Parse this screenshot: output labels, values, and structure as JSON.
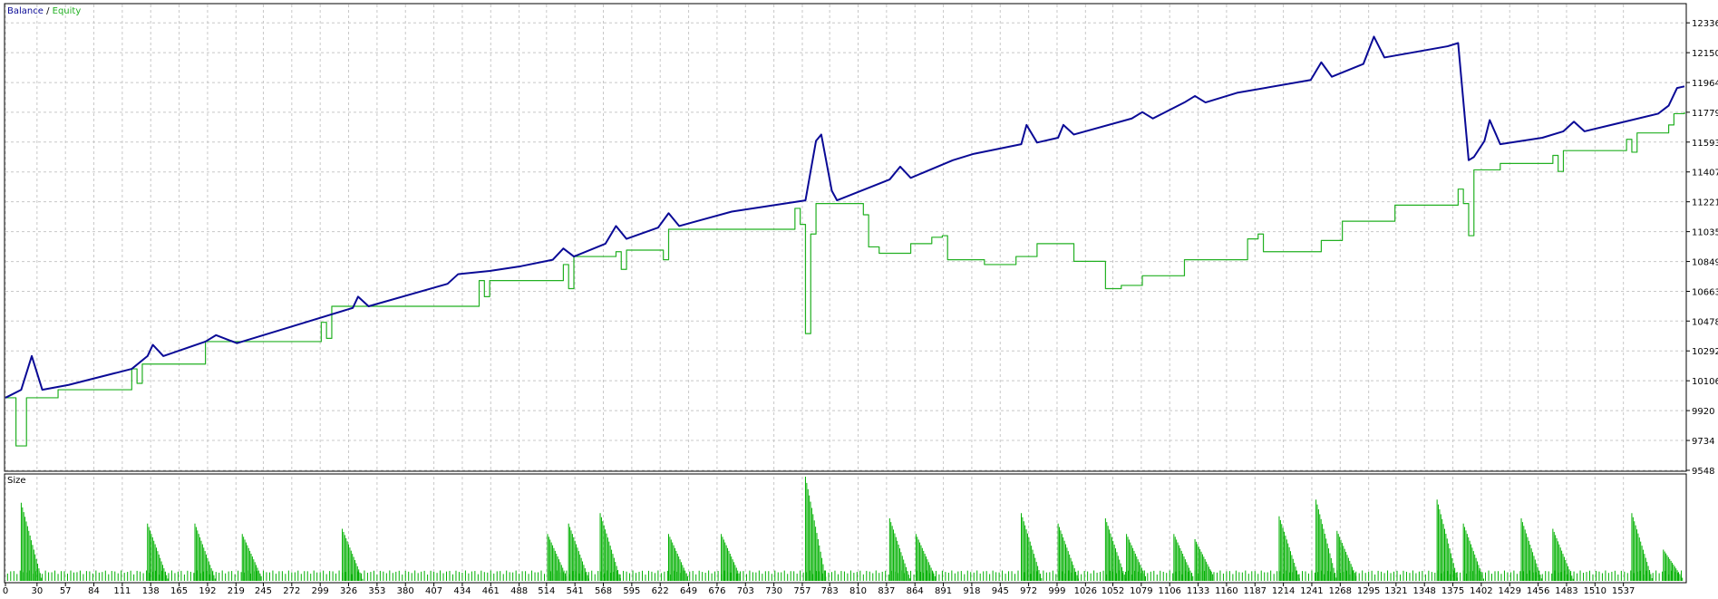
{
  "chart_data": [
    {
      "type": "line",
      "legend": {
        "balance_label": "Balance",
        "separator": " / ",
        "equity_label": "Equity",
        "placement": "top-left"
      },
      "colors": {
        "balance": "#0a0a96",
        "equity": "#22b022",
        "grid": "#c8c8c8",
        "axis": "#000000"
      },
      "grid": true,
      "ylim": [
        9548,
        12450
      ],
      "y_ticks": [
        9548,
        9734,
        9920,
        10106,
        10292,
        10478,
        10663,
        10849,
        11035,
        11221,
        11407,
        11593,
        11779,
        11964,
        12150,
        12336
      ],
      "xlim": [
        0,
        1595
      ],
      "series": [
        {
          "name": "Balance",
          "points": [
            [
              0,
              10000
            ],
            [
              15,
              10050
            ],
            [
              25,
              10260
            ],
            [
              35,
              10050
            ],
            [
              60,
              10080
            ],
            [
              120,
              10180
            ],
            [
              135,
              10260
            ],
            [
              140,
              10330
            ],
            [
              150,
              10260
            ],
            [
              190,
              10350
            ],
            [
              200,
              10390
            ],
            [
              220,
              10340
            ],
            [
              260,
              10420
            ],
            [
              330,
              10560
            ],
            [
              335,
              10630
            ],
            [
              345,
              10570
            ],
            [
              420,
              10710
            ],
            [
              430,
              10770
            ],
            [
              460,
              10790
            ],
            [
              490,
              10820
            ],
            [
              520,
              10860
            ],
            [
              530,
              10930
            ],
            [
              540,
              10880
            ],
            [
              570,
              10960
            ],
            [
              580,
              11070
            ],
            [
              590,
              10990
            ],
            [
              620,
              11060
            ],
            [
              630,
              11150
            ],
            [
              640,
              11070
            ],
            [
              690,
              11160
            ],
            [
              760,
              11230
            ],
            [
              770,
              11600
            ],
            [
              775,
              11640
            ],
            [
              785,
              11290
            ],
            [
              790,
              11230
            ],
            [
              840,
              11360
            ],
            [
              850,
              11440
            ],
            [
              860,
              11370
            ],
            [
              900,
              11480
            ],
            [
              920,
              11520
            ],
            [
              965,
              11580
            ],
            [
              970,
              11700
            ],
            [
              980,
              11590
            ],
            [
              1000,
              11620
            ],
            [
              1005,
              11700
            ],
            [
              1015,
              11640
            ],
            [
              1070,
              11740
            ],
            [
              1080,
              11780
            ],
            [
              1090,
              11740
            ],
            [
              1120,
              11840
            ],
            [
              1130,
              11880
            ],
            [
              1140,
              11840
            ],
            [
              1170,
              11900
            ],
            [
              1240,
              11980
            ],
            [
              1250,
              12090
            ],
            [
              1260,
              12000
            ],
            [
              1290,
              12080
            ],
            [
              1300,
              12250
            ],
            [
              1310,
              12120
            ],
            [
              1370,
              12190
            ],
            [
              1380,
              12210
            ],
            [
              1390,
              11480
            ],
            [
              1395,
              11500
            ],
            [
              1405,
              11600
            ],
            [
              1410,
              11730
            ],
            [
              1420,
              11580
            ],
            [
              1460,
              11620
            ],
            [
              1480,
              11660
            ],
            [
              1490,
              11720
            ],
            [
              1500,
              11660
            ],
            [
              1570,
              11770
            ],
            [
              1580,
              11820
            ],
            [
              1588,
              11930
            ],
            [
              1595,
              11940
            ]
          ]
        },
        {
          "name": "Equity",
          "points": [
            [
              0,
              10000
            ],
            [
              5,
              10000
            ],
            [
              10,
              9700
            ],
            [
              15,
              9700
            ],
            [
              20,
              10000
            ],
            [
              50,
              10050
            ],
            [
              120,
              10180
            ],
            [
              125,
              10090
            ],
            [
              130,
              10210
            ],
            [
              190,
              10350
            ],
            [
              300,
              10470
            ],
            [
              305,
              10370
            ],
            [
              310,
              10570
            ],
            [
              450,
              10730
            ],
            [
              455,
              10630
            ],
            [
              460,
              10730
            ],
            [
              530,
              10830
            ],
            [
              535,
              10680
            ],
            [
              540,
              10880
            ],
            [
              580,
              10910
            ],
            [
              585,
              10800
            ],
            [
              590,
              10920
            ],
            [
              620,
              10920
            ],
            [
              625,
              10860
            ],
            [
              630,
              11050
            ],
            [
              750,
              11180
            ],
            [
              755,
              11080
            ],
            [
              760,
              10400
            ],
            [
              765,
              11020
            ],
            [
              770,
              11210
            ],
            [
              810,
              11210
            ],
            [
              815,
              11140
            ],
            [
              820,
              10940
            ],
            [
              830,
              10900
            ],
            [
              860,
              10960
            ],
            [
              880,
              11000
            ],
            [
              890,
              11010
            ],
            [
              895,
              10860
            ],
            [
              930,
              10830
            ],
            [
              960,
              10880
            ],
            [
              980,
              10960
            ],
            [
              1010,
              10960
            ],
            [
              1015,
              10850
            ],
            [
              1040,
              10850
            ],
            [
              1045,
              10680
            ],
            [
              1060,
              10700
            ],
            [
              1080,
              10760
            ],
            [
              1120,
              10860
            ],
            [
              1180,
              10990
            ],
            [
              1190,
              11020
            ],
            [
              1195,
              10910
            ],
            [
              1250,
              10980
            ],
            [
              1270,
              11100
            ],
            [
              1320,
              11200
            ],
            [
              1380,
              11300
            ],
            [
              1385,
              11210
            ],
            [
              1390,
              11010
            ],
            [
              1395,
              11420
            ],
            [
              1420,
              11460
            ],
            [
              1470,
              11510
            ],
            [
              1475,
              11410
            ],
            [
              1480,
              11540
            ],
            [
              1540,
              11610
            ],
            [
              1545,
              11530
            ],
            [
              1550,
              11650
            ],
            [
              1580,
              11700
            ],
            [
              1585,
              11770
            ],
            [
              1595,
              11780
            ]
          ]
        }
      ],
      "y_axis_side": "right"
    },
    {
      "type": "bar",
      "title": "Size",
      "color": "#00b000",
      "x_ticks": [
        0,
        30,
        57,
        84,
        111,
        138,
        165,
        192,
        219,
        245,
        272,
        299,
        326,
        353,
        380,
        407,
        434,
        461,
        488,
        514,
        541,
        568,
        595,
        622,
        649,
        676,
        703,
        730,
        757,
        783,
        810,
        837,
        864,
        891,
        918,
        945,
        972,
        999,
        1026,
        1052,
        1079,
        1106,
        1133,
        1160,
        1187,
        1214,
        1241,
        1268,
        1295,
        1321,
        1348,
        1375,
        1402,
        1429,
        1456,
        1483,
        1510,
        1537
      ],
      "xlim": [
        0,
        1595
      ],
      "ylim": [
        0,
        1
      ],
      "spikes": [
        {
          "x": 15,
          "h": 0.75
        },
        {
          "x": 135,
          "h": 0.55
        },
        {
          "x": 180,
          "h": 0.55
        },
        {
          "x": 225,
          "h": 0.45
        },
        {
          "x": 320,
          "h": 0.5
        },
        {
          "x": 515,
          "h": 0.45
        },
        {
          "x": 535,
          "h": 0.55
        },
        {
          "x": 565,
          "h": 0.65
        },
        {
          "x": 630,
          "h": 0.45
        },
        {
          "x": 680,
          "h": 0.45
        },
        {
          "x": 760,
          "h": 1.0
        },
        {
          "x": 840,
          "h": 0.6
        },
        {
          "x": 865,
          "h": 0.45
        },
        {
          "x": 965,
          "h": 0.65
        },
        {
          "x": 1000,
          "h": 0.55
        },
        {
          "x": 1045,
          "h": 0.6
        },
        {
          "x": 1065,
          "h": 0.45
        },
        {
          "x": 1110,
          "h": 0.45
        },
        {
          "x": 1130,
          "h": 0.4
        },
        {
          "x": 1210,
          "h": 0.62
        },
        {
          "x": 1245,
          "h": 0.78
        },
        {
          "x": 1265,
          "h": 0.48
        },
        {
          "x": 1360,
          "h": 0.78
        },
        {
          "x": 1385,
          "h": 0.55
        },
        {
          "x": 1440,
          "h": 0.6
        },
        {
          "x": 1470,
          "h": 0.5
        },
        {
          "x": 1545,
          "h": 0.65
        },
        {
          "x": 1575,
          "h": 0.3
        }
      ],
      "baseline_level": 0.1
    }
  ]
}
